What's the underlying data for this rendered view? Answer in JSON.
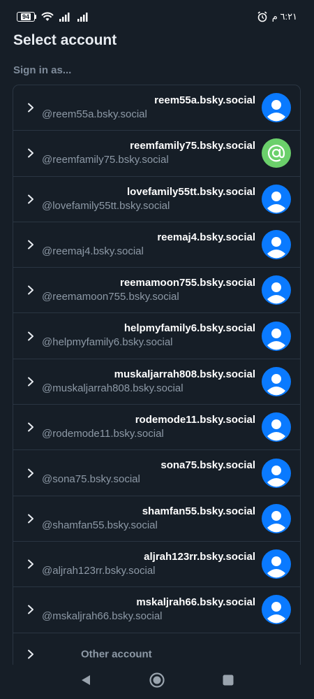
{
  "status_bar": {
    "battery": "94",
    "time": "٦:٢١ م"
  },
  "header": {
    "title": "Select account",
    "subtitle": "Sign in as..."
  },
  "accounts": [
    {
      "name": "reem55a.bsky.social",
      "handle": "@reem55a.bsky.social",
      "avatar": "person-icon"
    },
    {
      "name": "reemfamily75.bsky.social",
      "handle": "@reemfamily75.bsky.social",
      "avatar": "at-icon"
    },
    {
      "name": "lovefamily55tt.bsky.social",
      "handle": "@lovefamily55tt.bsky.social",
      "avatar": "person-icon"
    },
    {
      "name": "reemaj4.bsky.social",
      "handle": "@reemaj4.bsky.social",
      "avatar": "person-icon"
    },
    {
      "name": "reemamoon755.bsky.social",
      "handle": "@reemamoon755.bsky.social",
      "avatar": "person-icon"
    },
    {
      "name": "helpmyfamily6.bsky.social",
      "handle": "@helpmyfamily6.bsky.social",
      "avatar": "person-icon"
    },
    {
      "name": "muskaljarrah808.bsky.social",
      "handle": "@muskaljarrah808.bsky.social",
      "avatar": "person-icon"
    },
    {
      "name": "rodemode11.bsky.social",
      "handle": "@rodemode11.bsky.social",
      "avatar": "person-icon"
    },
    {
      "name": "sona75.bsky.social",
      "handle": "@sona75.bsky.social",
      "avatar": "person-icon"
    },
    {
      "name": "shamfan55.bsky.social",
      "handle": "@shamfan55.bsky.social",
      "avatar": "person-icon"
    },
    {
      "name": "aljrah123rr.bsky.social",
      "handle": "@aljrah123rr.bsky.social",
      "avatar": "person-icon"
    },
    {
      "name": "mskaljrah66.bsky.social",
      "handle": "@mskaljrah66.bsky.social",
      "avatar": "person-icon"
    }
  ],
  "other_account": {
    "label": "Other account"
  },
  "colors": {
    "background": "#161e27",
    "avatar_blue": "#0a7aff",
    "avatar_green": "#6bd06b",
    "muted_text": "#8d99a6",
    "border": "#2a3542"
  }
}
